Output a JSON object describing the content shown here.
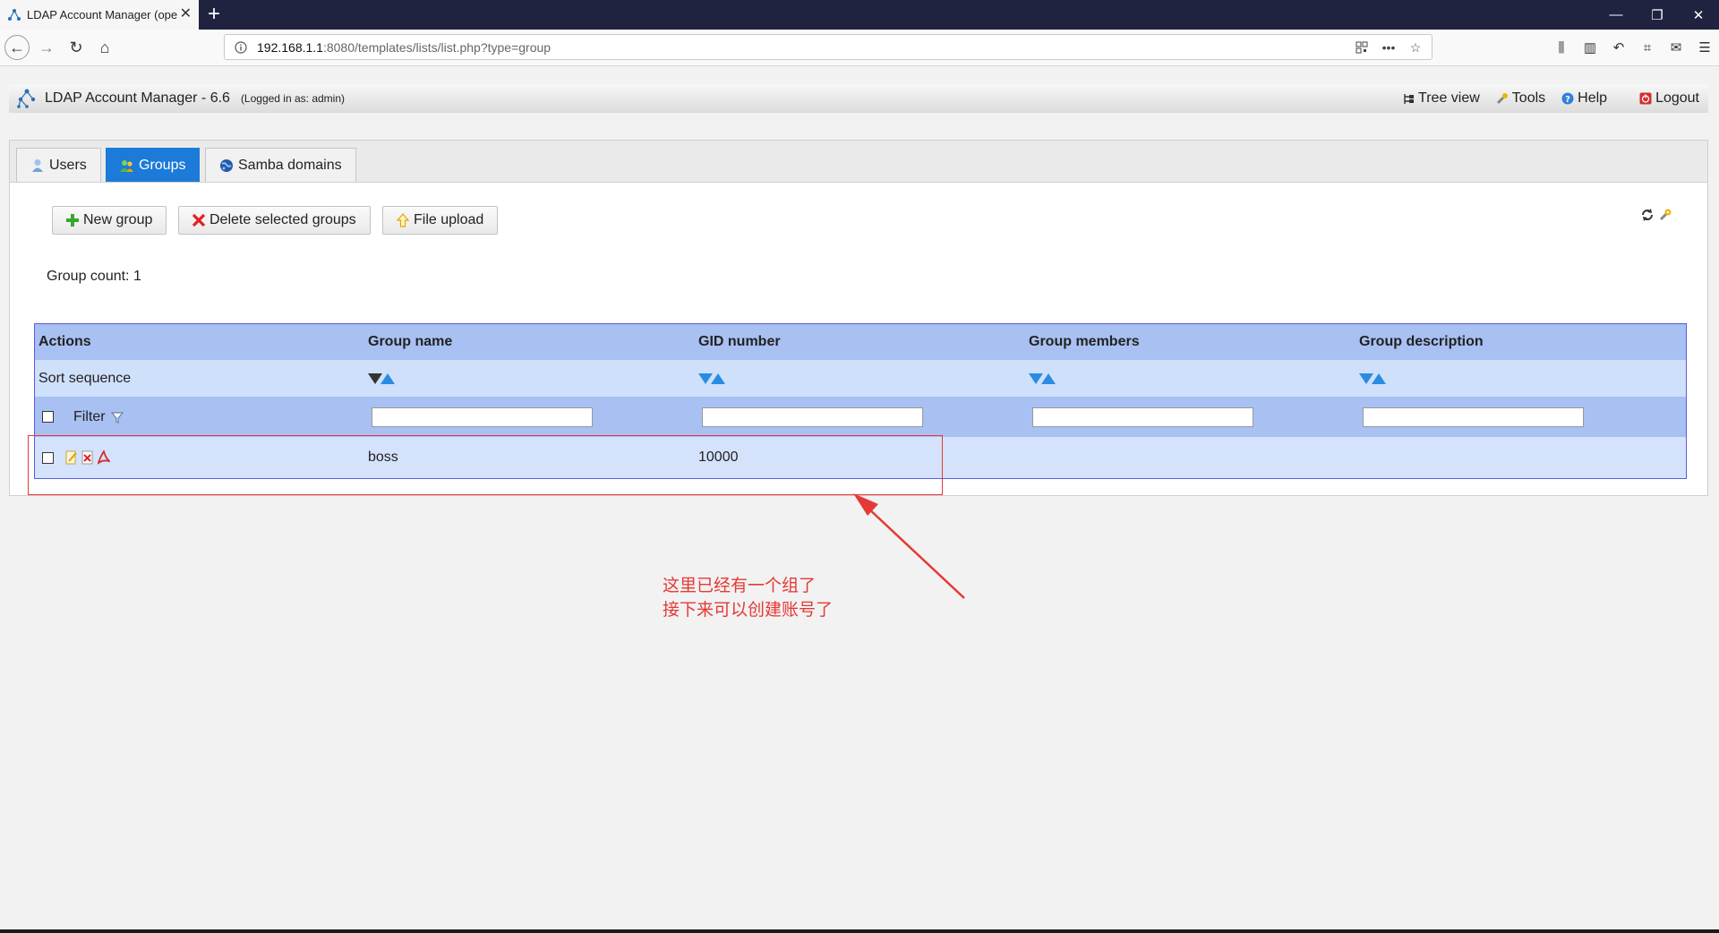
{
  "browser": {
    "tab_title": "LDAP Account Manager (opе",
    "url_host": "192.168.1.1",
    "url_rest": ":8080/templates/lists/list.php?type=group"
  },
  "header": {
    "title": "LDAP Account Manager - 6.6",
    "logged_in": "(Logged in as: admin)",
    "links": {
      "tree_view": "Tree view",
      "tools": "Tools",
      "help": "Help",
      "logout": "Logout"
    }
  },
  "tabs": {
    "users": "Users",
    "groups": "Groups",
    "samba": "Samba domains",
    "active": "groups"
  },
  "toolbar": {
    "new_group": "New group",
    "delete_selected": "Delete selected groups",
    "file_upload": "File upload"
  },
  "group_count": "Group count: 1",
  "table": {
    "columns": [
      "Actions",
      "Group name",
      "GID number",
      "Group members",
      "Group description"
    ],
    "sort_label": "Sort sequence",
    "filter_label": "Filter",
    "rows": [
      {
        "group_name": "boss",
        "gid": "10000",
        "members": "",
        "description": ""
      }
    ]
  },
  "annotation": {
    "line1": "这里已经有一个组了",
    "line2": "接下来可以创建账号了",
    "color": "#e53935"
  }
}
